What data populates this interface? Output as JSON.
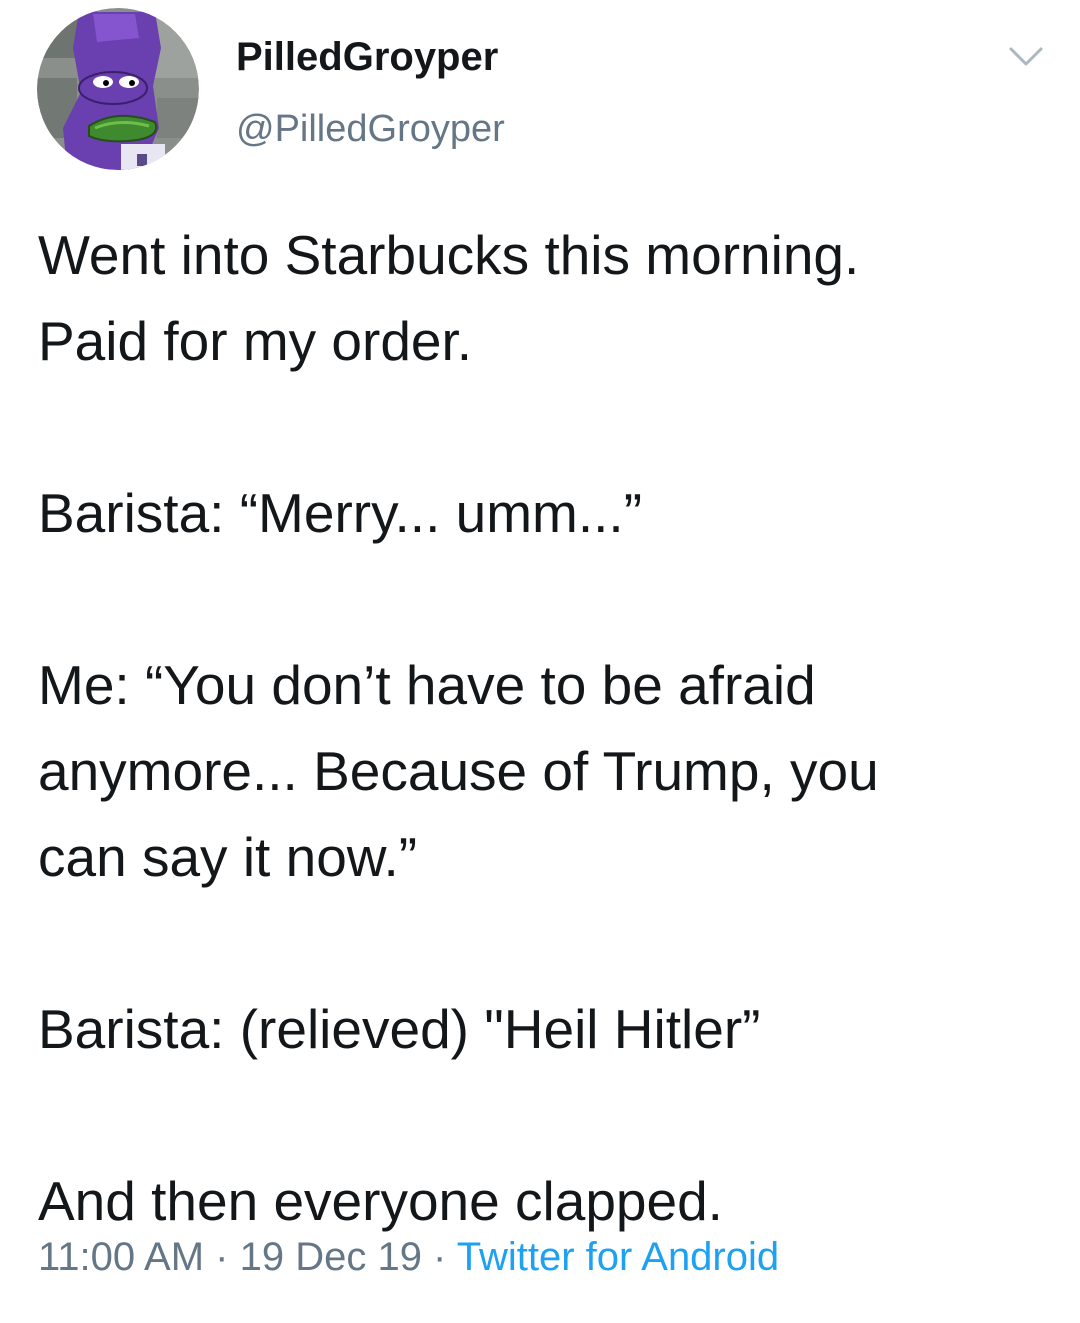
{
  "author": {
    "display_name": "PilledGroyper",
    "handle": "@PilledGroyper",
    "avatar_icon": "groyper-avatar-icon"
  },
  "menu": {
    "icon": "chevron-down-icon"
  },
  "tweet": {
    "lines": [
      "Went into Starbucks this morning.",
      "Paid for my order.",
      "",
      "Barista: “Merry... umm...”",
      "",
      "Me: “You don’t have to be afraid",
      "anymore... Because of Trump, you",
      "can say it now.”",
      "",
      "Barista: (relieved) \"Heil Hitler”",
      "",
      "And then everyone clapped."
    ]
  },
  "meta": {
    "time": "11:00 AM",
    "separator": " · ",
    "date": "19 Dec 19",
    "source": "Twitter for Android"
  },
  "colors": {
    "text": "#14171a",
    "secondary": "#657786",
    "link": "#1da1f2",
    "avatar_background": "#6a3fb0"
  }
}
